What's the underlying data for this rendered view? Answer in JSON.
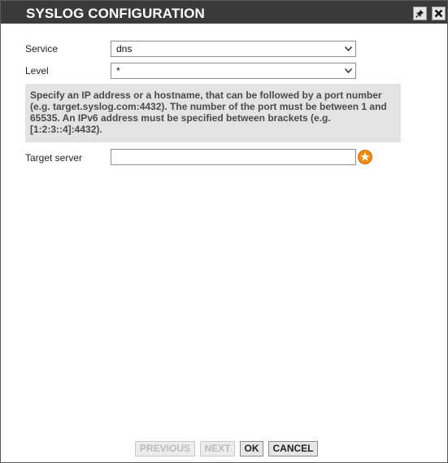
{
  "dialog": {
    "title": "SYSLOG CONFIGURATION",
    "pin_icon": "pin-icon",
    "close_icon": "close-icon"
  },
  "form": {
    "service": {
      "label": "Service",
      "value": "dns"
    },
    "level": {
      "label": "Level",
      "value": "*"
    },
    "info_text": "Specify an IP address or a hostname, that can be followed by a port number (e.g. target.syslog.com:4432). The number of the port must be between 1 and 65535. An IPv6 address must be specified between brackets (e.g. [1:2:3::4]:4432).",
    "target_server": {
      "label": "Target server",
      "value": "",
      "required_icon": "required-star-icon"
    }
  },
  "footer": {
    "previous_label": "PREVIOUS",
    "next_label": "NEXT",
    "ok_label": "OK",
    "cancel_label": "CANCEL"
  },
  "colors": {
    "titlebar": "#3b3b3b",
    "info_background": "#e3e3e3",
    "required_icon": "#f08a0c"
  }
}
